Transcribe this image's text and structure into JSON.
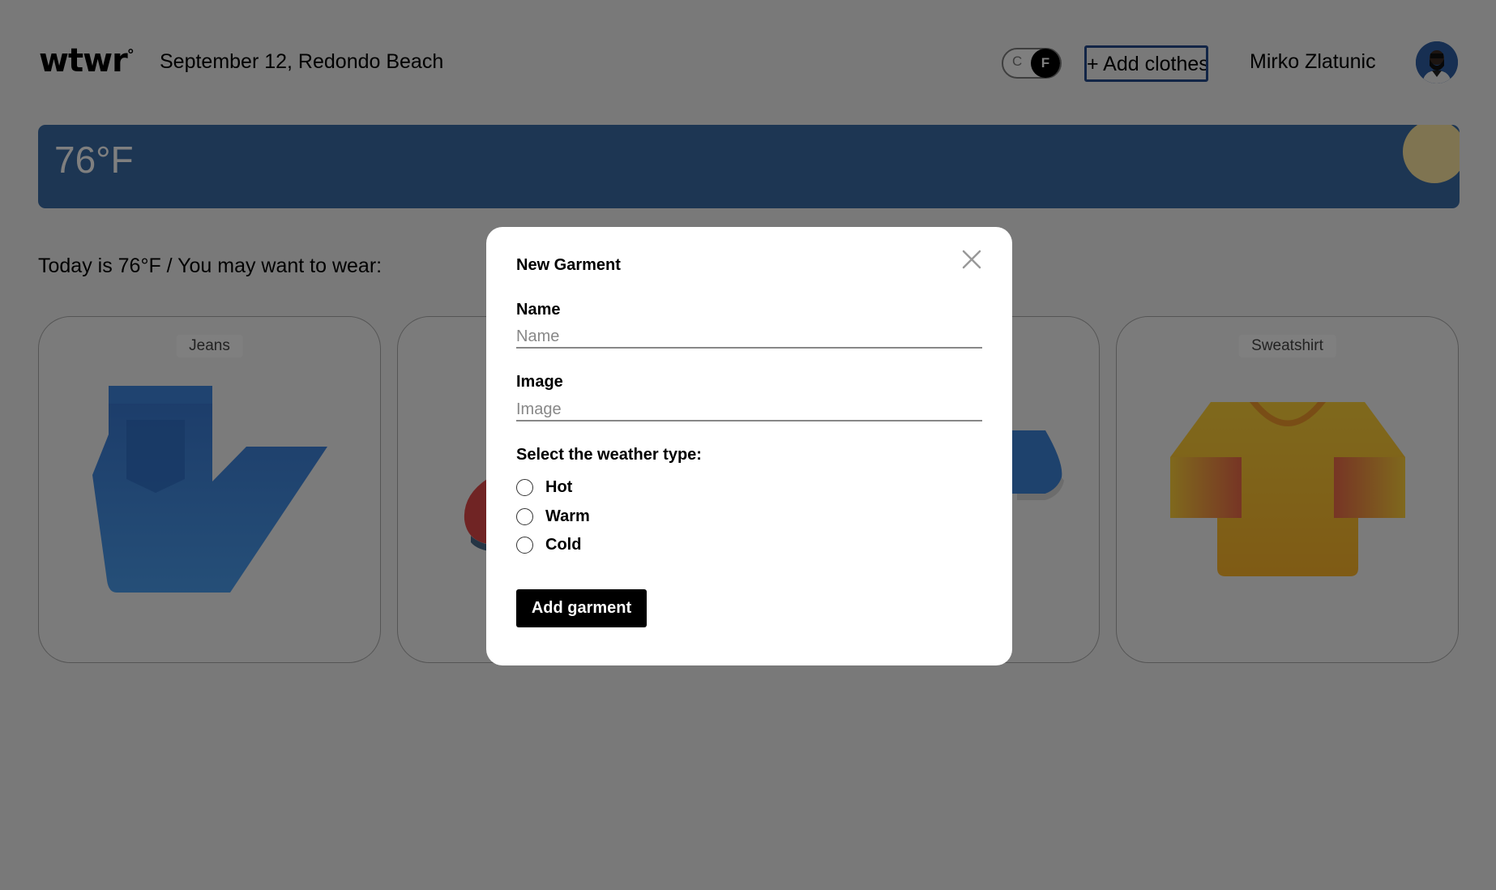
{
  "header": {
    "logo": "wtwr",
    "logo_mark": "°",
    "date_location": "September 12, Redondo Beach",
    "toggle": {
      "option_c": "C",
      "option_f": "F",
      "selected": "F"
    },
    "add_clothes_label": "+ Add clothes",
    "username": "Mirko Zlatunic",
    "avatar_icon": "user-avatar-icon"
  },
  "weather": {
    "temperature": "76°F",
    "condition_icon": "sun-icon",
    "banner_color": "#3b6da6"
  },
  "main": {
    "today_text": "Today is 76°F / You may want to wear:",
    "cards": [
      {
        "label": "Jeans",
        "icon": "jeans-icon"
      },
      {
        "label": "",
        "icon": "cap-icon"
      },
      {
        "label": "",
        "icon": "sneaker-icon"
      },
      {
        "label": "Sweatshirt",
        "icon": "sweatshirt-icon"
      }
    ]
  },
  "modal": {
    "title": "New Garment",
    "close_icon": "close-icon",
    "name_label": "Name",
    "name_placeholder": "Name",
    "name_value": "",
    "image_label": "Image",
    "image_placeholder": "Image",
    "image_value": "",
    "weather_question": "Select the weather type:",
    "weather_options": [
      "Hot",
      "Warm",
      "Cold"
    ],
    "submit_label": "Add garment"
  },
  "colors": {
    "accent": "#254a8d",
    "banner": "#3b6da6",
    "sun": "#ffe9a3",
    "overlay": "rgba(0,0,0,0.5)"
  }
}
